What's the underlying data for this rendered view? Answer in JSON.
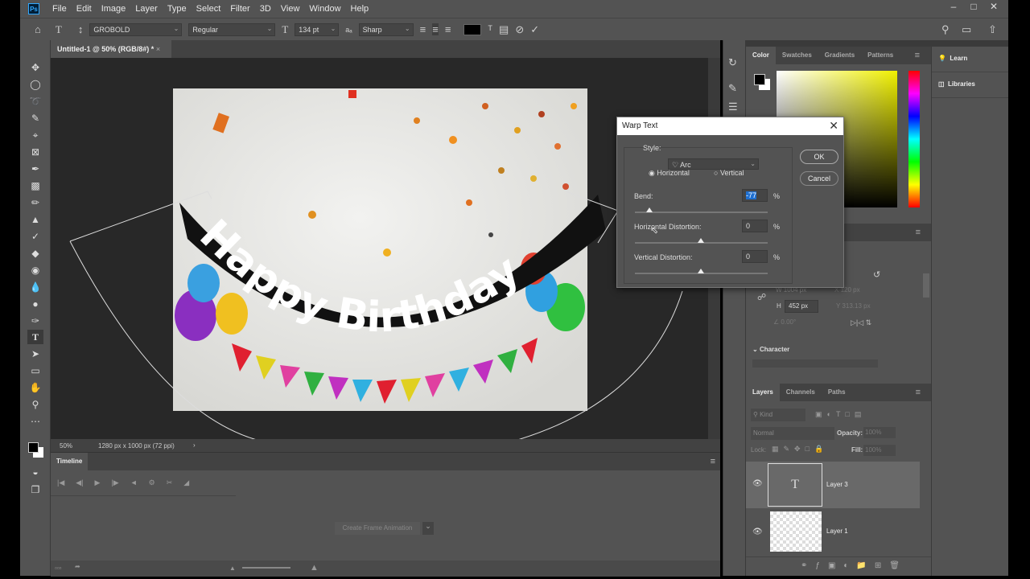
{
  "menubar": {
    "logo": "Ps",
    "items": [
      "File",
      "Edit",
      "Image",
      "Layer",
      "Type",
      "Select",
      "Filter",
      "3D",
      "View",
      "Window",
      "Help"
    ]
  },
  "options": {
    "font_family": "GROBOLD",
    "font_style": "Regular",
    "font_size": "134 pt",
    "anti_alias": "Sharp",
    "text_color": "#000000"
  },
  "document": {
    "tab_title": "Untitled-1 @ 50% (RGB/8#) *",
    "zoom": "50%",
    "doc_info": "1280 px x 1000 px (72 ppi)",
    "warped_text": "Happy Birthday"
  },
  "timeline": {
    "title": "Timeline",
    "create_button": "Create Frame Animation"
  },
  "color_panel": {
    "tabs": [
      "Color",
      "Swatches",
      "Gradients",
      "Patterns"
    ],
    "foreground": "#000000",
    "background": "#ffffff"
  },
  "learn_panel": {
    "items": [
      "Learn",
      "Libraries"
    ]
  },
  "properties": {
    "w": "1004 px",
    "x": "120 px",
    "h": "452 px",
    "y": "313.13 px",
    "angle": "0.00°",
    "character_section": "Character"
  },
  "layers_panel": {
    "tabs": [
      "Layers",
      "Channels",
      "Paths"
    ],
    "kind_placeholder": "Kind",
    "blend_mode": "Normal",
    "opacity_label": "Opacity:",
    "opacity": "100%",
    "lock_label": "Lock:",
    "fill_label": "Fill:",
    "fill": "100%",
    "layers": [
      {
        "name": "Layer 3",
        "type": "text",
        "selected": true
      },
      {
        "name": "Layer 1",
        "type": "image",
        "selected": false
      }
    ]
  },
  "warp_dialog": {
    "title": "Warp Text",
    "style_label": "Style:",
    "style_value": "Arc",
    "orientation_horizontal": "Horizontal",
    "orientation_vertical": "Vertical",
    "orientation_selected": "Horizontal",
    "bend_label": "Bend:",
    "bend": "-77",
    "hdist_label": "Horizontal Distortion:",
    "hdist": "0",
    "vdist_label": "Vertical Distortion:",
    "vdist": "0",
    "percent": "%",
    "ok": "OK",
    "cancel": "Cancel"
  }
}
